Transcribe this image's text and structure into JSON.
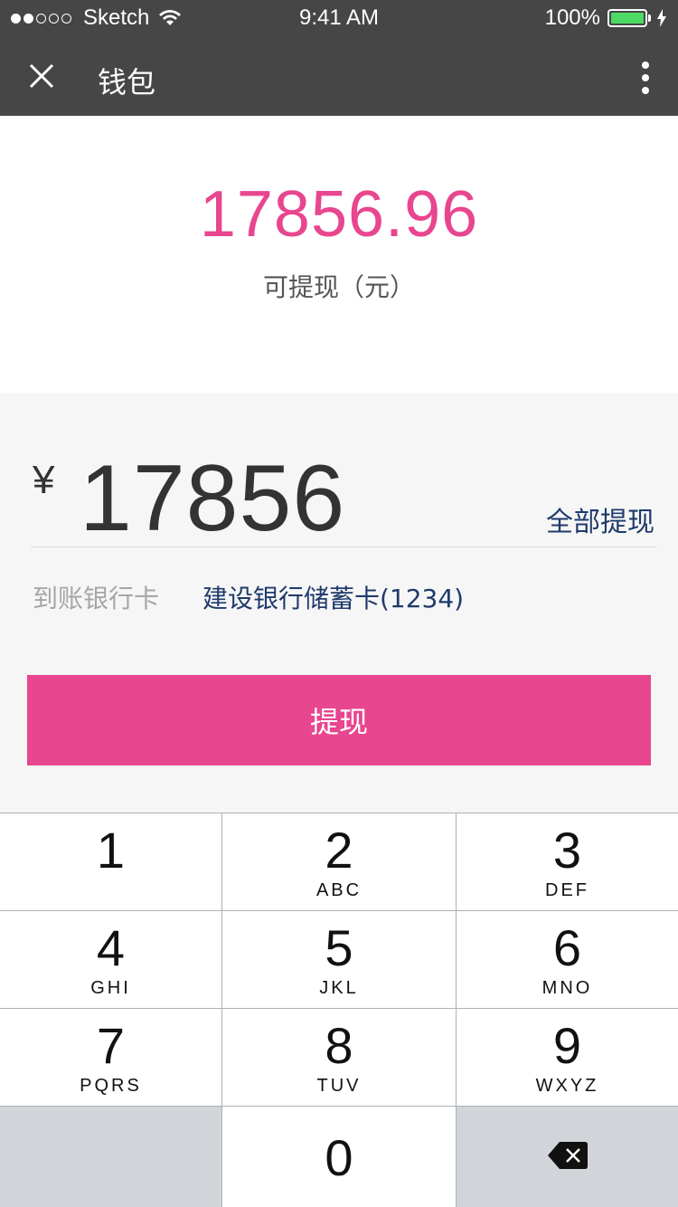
{
  "status_bar": {
    "carrier": "Sketch",
    "time": "9:41 AM",
    "battery": "100%",
    "signal_filled": 2,
    "signal_total": 5
  },
  "nav": {
    "title": "钱包"
  },
  "balance": {
    "amount": "17856.96",
    "label": "可提现（元）"
  },
  "withdraw": {
    "currency": "¥",
    "amount": "17856",
    "withdraw_all": "全部提现",
    "bank_label": "到账银行卡",
    "bank_value": "建设银行储蓄卡(1234)",
    "submit": "提现"
  },
  "keypad": {
    "keys": [
      {
        "digit": "1",
        "letters": ""
      },
      {
        "digit": "2",
        "letters": "ABC"
      },
      {
        "digit": "3",
        "letters": "DEF"
      },
      {
        "digit": "4",
        "letters": "GHI"
      },
      {
        "digit": "5",
        "letters": "JKL"
      },
      {
        "digit": "6",
        "letters": "MNO"
      },
      {
        "digit": "7",
        "letters": "PQRS"
      },
      {
        "digit": "8",
        "letters": "TUV"
      },
      {
        "digit": "9",
        "letters": "WXYZ"
      },
      {
        "digit": "0",
        "letters": ""
      }
    ]
  },
  "colors": {
    "accent": "#e8468f",
    "bar": "#464646",
    "link": "#1f3a6b"
  }
}
